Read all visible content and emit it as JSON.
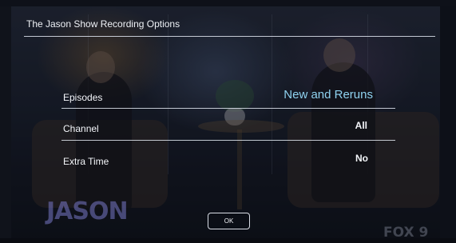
{
  "dialog": {
    "title": "The Jason Show Recording Options",
    "ok_label": "OK"
  },
  "options": [
    {
      "label": "Episodes",
      "value": "New and Reruns",
      "selected": true
    },
    {
      "label": "Channel",
      "value": "All",
      "selected": false
    },
    {
      "label": "Extra Time",
      "value": "No",
      "selected": false
    }
  ],
  "background": {
    "show_logo_text": "JASON",
    "network_logo_text": "FOX 9"
  },
  "colors": {
    "selected_value": "#8fd2f0",
    "text": "#f4f6fa",
    "rule": "#e1e6f0"
  }
}
